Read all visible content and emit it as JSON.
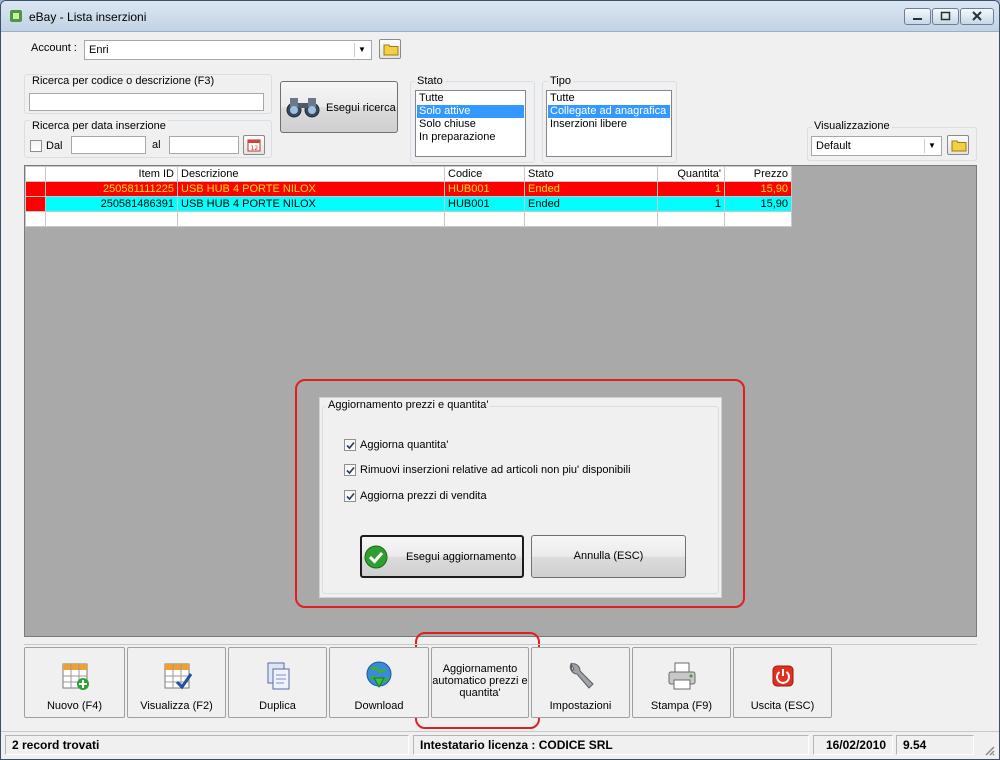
{
  "window": {
    "title": "eBay - Lista inserzioni"
  },
  "account": {
    "label": "Account :",
    "value": "Enri"
  },
  "search": {
    "code_group_title": "Ricerca per codice o descrizione (F3)",
    "code_value": "",
    "date_group_title": "Ricerca per data inserzione",
    "from_label": "Dal",
    "to_label": "al",
    "from_checked": false,
    "search_button": "Esegui ricerca"
  },
  "stato": {
    "title": "Stato",
    "items": [
      "Tutte",
      "Solo attive",
      "Solo chiuse",
      "In preparazione"
    ],
    "selected": 1
  },
  "tipo": {
    "title": "Tipo",
    "items": [
      "Tutte",
      "Collegate ad anagrafica",
      "Inserzioni libere"
    ],
    "selected": 1
  },
  "visualizzazione": {
    "title": "Visualizzazione",
    "value": "Default"
  },
  "grid": {
    "columns": [
      "Item ID",
      "Descrizione",
      "Codice",
      "Stato",
      "Quantita'",
      "Prezzo"
    ],
    "rows": [
      {
        "item_id": "250581111225",
        "descrizione": "USB HUB 4 PORTE NILOX",
        "codice": "HUB001",
        "stato": "Ended",
        "quantita": "1",
        "prezzo": "15,90"
      },
      {
        "item_id": "250581486391",
        "descrizione": "USB HUB 4 PORTE NILOX",
        "codice": "HUB001",
        "stato": "Ended",
        "quantita": "1",
        "prezzo": "15,90"
      }
    ]
  },
  "dialog": {
    "title": "Aggiornamento prezzi e quantita'",
    "options": [
      {
        "label": "Aggiorna quantita'",
        "checked": true
      },
      {
        "label": "Rimuovi inserzioni relative ad articoli non piu' disponibili",
        "checked": true
      },
      {
        "label": "Aggiorna prezzi di vendita",
        "checked": true
      }
    ],
    "run_button": "Esegui aggiornamento",
    "cancel_button": "Annulla (ESC)"
  },
  "toolbar": {
    "nuovo": "Nuovo (F4)",
    "visualizza": "Visualizza (F2)",
    "duplica": "Duplica",
    "download": "Download",
    "aggiornamento_line1": "Aggiornamento",
    "aggiornamento_line2": "automatico prezzi e",
    "aggiornamento_line3": "quantita'",
    "impostazioni": "Impostazioni",
    "stampa": "Stampa (F9)",
    "uscita": "Uscita (ESC)"
  },
  "status": {
    "records": "2 record trovati",
    "license": "Intestatario licenza : CODICE SRL",
    "date": "16/02/2010",
    "time": "9.54"
  },
  "colors": {
    "highlight": "#e02020",
    "row_red": "#ff0000",
    "row_cyan": "#00ffff",
    "selection": "#3399ff"
  }
}
